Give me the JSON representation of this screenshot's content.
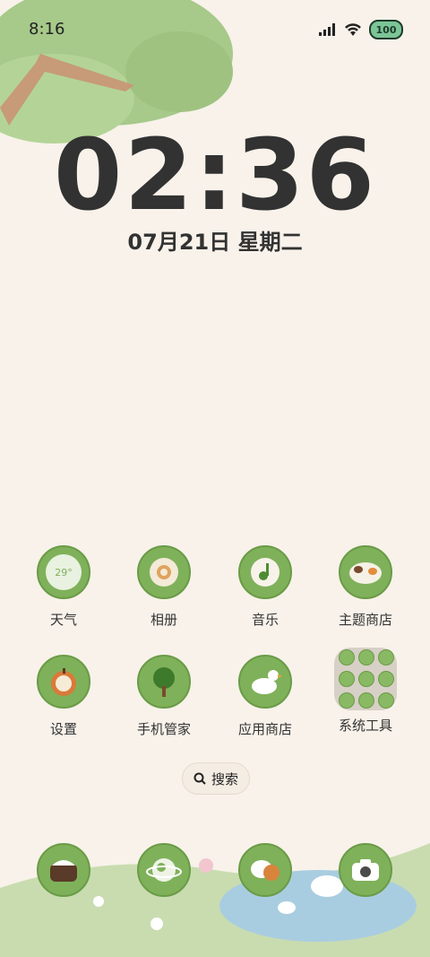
{
  "status_bar": {
    "time": "8:16",
    "battery": "100"
  },
  "lock": {
    "clock": "02:36",
    "date": "07月21日 星期二"
  },
  "apps": [
    {
      "label": "天气",
      "icon": "weather-icon"
    },
    {
      "label": "相册",
      "icon": "gallery-icon"
    },
    {
      "label": "音乐",
      "icon": "music-icon"
    },
    {
      "label": "主题商店",
      "icon": "theme-store-icon"
    },
    {
      "label": "设置",
      "icon": "settings-icon"
    },
    {
      "label": "手机管家",
      "icon": "phone-manager-icon"
    },
    {
      "label": "应用商店",
      "icon": "app-store-icon"
    },
    {
      "label": "系统工具",
      "icon": "system-tools-folder-icon"
    }
  ],
  "weather_icon_text": "29°",
  "search": {
    "label": "搜索"
  },
  "dock": [
    {
      "icon": "phone-icon"
    },
    {
      "icon": "browser-icon"
    },
    {
      "icon": "messages-icon"
    },
    {
      "icon": "camera-icon"
    }
  ],
  "colors": {
    "background": "#f8f2ea",
    "icon_green": "#7fb15a",
    "text": "#323232"
  }
}
